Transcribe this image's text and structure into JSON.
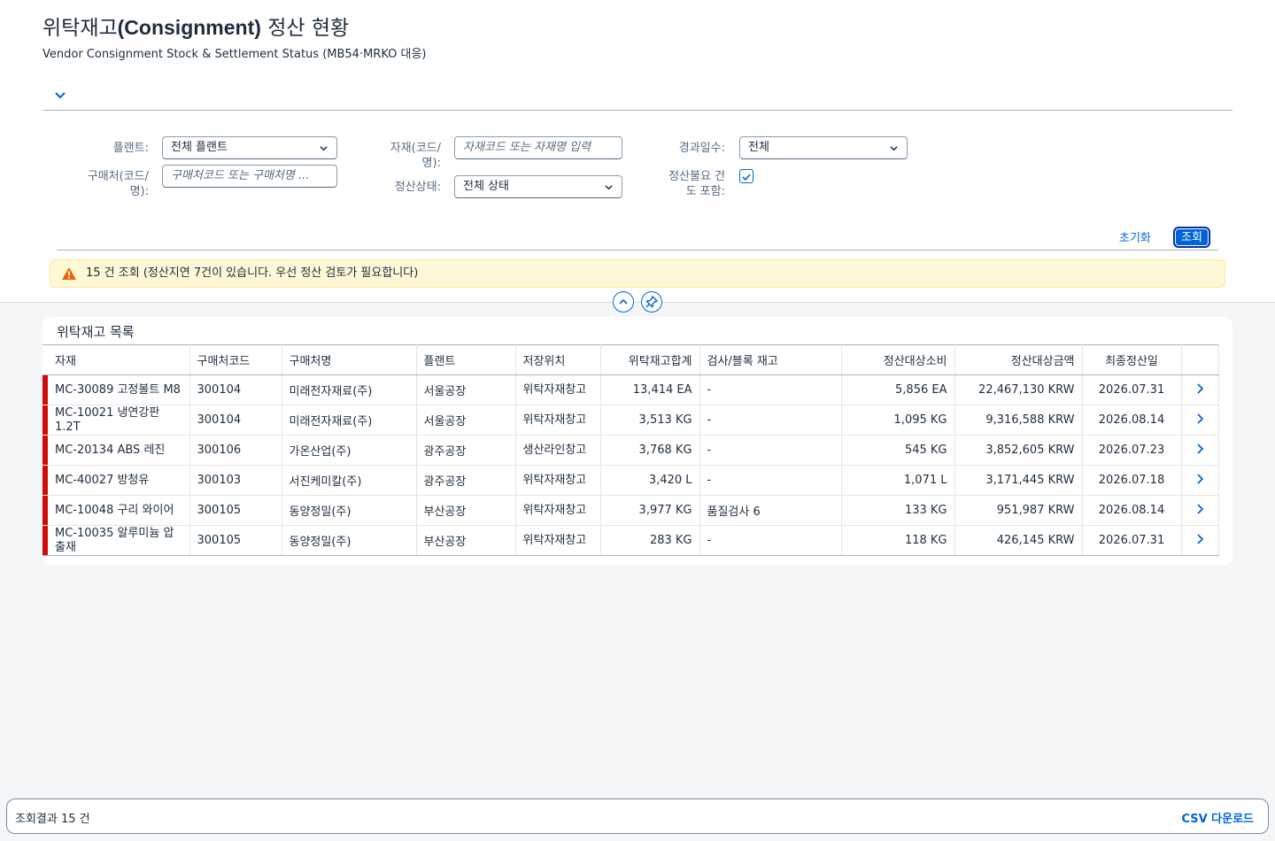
{
  "page": {
    "title_prefix": "위탁재고",
    "title_bold": "(Consignment)",
    "title_suffix": " 정산 현황",
    "subtitle": "Vendor Consignment Stock & Settlement Status (MB54·MRKO 대응)"
  },
  "filters": {
    "plant_label": "플랜트:",
    "plant_value": "전체 플랜트",
    "vendor_label_1": "구매처(코드/",
    "vendor_label_2": "명):",
    "vendor_placeholder": "구매처코드 또는 구매처명 ...",
    "material_label_1": "자재(코드/",
    "material_label_2": "명):",
    "material_placeholder": "자재코드 또는 자재명 입력",
    "status_label": "정산상태:",
    "status_value": "전체 상태",
    "days_label": "경과일수:",
    "days_value": "전체",
    "include_label_1": "정산불요 건",
    "include_label_2": "도 포함:",
    "include_checked": true
  },
  "actions": {
    "reset": "초기화",
    "search": "조회"
  },
  "message": {
    "text": "15 건 조회 (정산지연 7건이 있습니다. 우선 정산 검토가 필요합니다)",
    "type": "warning"
  },
  "table": {
    "title": "위탁재고 목록",
    "columns": [
      "자재",
      "구매처코드",
      "구매처명",
      "플랜트",
      "저장위치",
      "위탁재고합계",
      "검사/블록 재고",
      "정산대상소비",
      "정산대상금액",
      "최종정산일"
    ],
    "rows": [
      {
        "material": "MC-30089 고정볼트 M8",
        "vendor_code": "300104",
        "vendor_name": "미래전자재료(주)",
        "plant": "서울공장",
        "sloc": "위탁자재창고",
        "stock": "13,414 EA",
        "blocked": "-",
        "consumption": "5,856 EA",
        "amount": "22,467,130 KRW",
        "last_date": "2026.07.31"
      },
      {
        "material": "MC-10021 냉연강판 1.2T",
        "vendor_code": "300104",
        "vendor_name": "미래전자재료(주)",
        "plant": "서울공장",
        "sloc": "위탁자재창고",
        "stock": "3,513 KG",
        "blocked": "-",
        "consumption": "1,095 KG",
        "amount": "9,316,588 KRW",
        "last_date": "2026.08.14"
      },
      {
        "material": "MC-20134 ABS 레진",
        "vendor_code": "300106",
        "vendor_name": "가온산업(주)",
        "plant": "광주공장",
        "sloc": "생산라인창고",
        "stock": "3,768 KG",
        "blocked": "-",
        "consumption": "545 KG",
        "amount": "3,852,605 KRW",
        "last_date": "2026.07.23"
      },
      {
        "material": "MC-40027 방청유",
        "vendor_code": "300103",
        "vendor_name": "서진케미칼(주)",
        "plant": "광주공장",
        "sloc": "위탁자재창고",
        "stock": "3,420 L",
        "blocked": "-",
        "consumption": "1,071 L",
        "amount": "3,171,445 KRW",
        "last_date": "2026.07.18"
      },
      {
        "material": "MC-10048 구리 와이어",
        "vendor_code": "300105",
        "vendor_name": "동양정밀(주)",
        "plant": "부산공장",
        "sloc": "위탁자재창고",
        "stock": "3,977 KG",
        "blocked": "품질검사 6",
        "consumption": "133 KG",
        "amount": "951,987 KRW",
        "last_date": "2026.08.14"
      },
      {
        "material": "MC-10035 알루미늄 압출재",
        "vendor_code": "300105",
        "vendor_name": "동양정밀(주)",
        "plant": "부산공장",
        "sloc": "위탁자재창고",
        "stock": "283 KG",
        "blocked": "-",
        "consumption": "118 KG",
        "amount": "426,145 KRW",
        "last_date": "2026.07.31"
      }
    ]
  },
  "footer": {
    "result_text": "조회결과 15 건",
    "csv": "CSV 다운로드"
  },
  "colors": {
    "accent": "#0064d9",
    "warning_bg": "#fff8d6",
    "row_marker": "#d20a0a"
  }
}
